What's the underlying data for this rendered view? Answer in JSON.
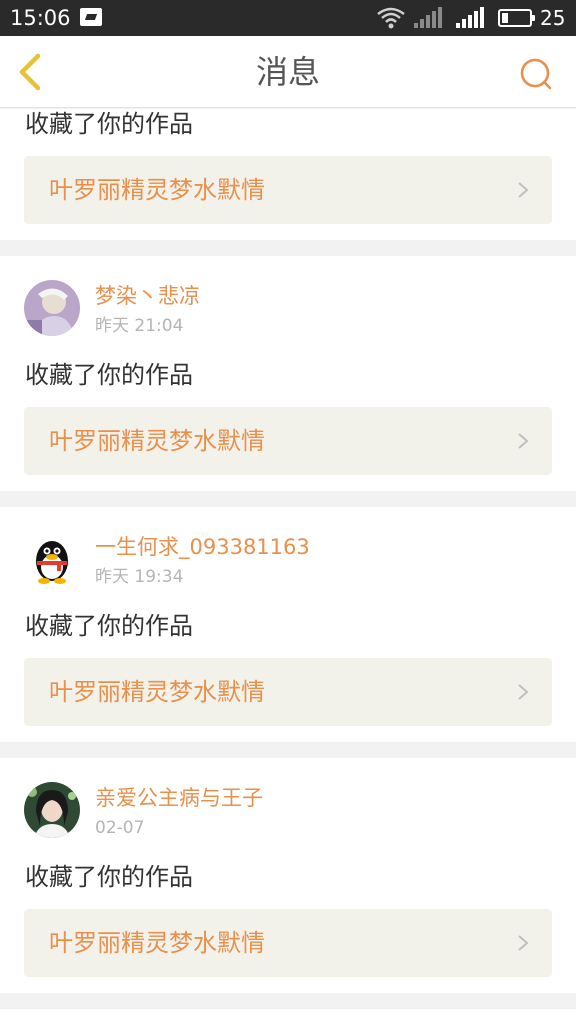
{
  "status_bar": {
    "time": "15:06",
    "battery_level": "25",
    "icons": [
      "image-notification-icon",
      "wifi-icon",
      "signal-empty-icon",
      "signal-icon",
      "battery-icon"
    ]
  },
  "header": {
    "title": "消息",
    "back_icon": "chevron-left-icon",
    "search_icon": "search-icon"
  },
  "colors": {
    "accent": "#e8904c",
    "back_chevron": "#e5c23a",
    "link_bg": "#f3f2ea",
    "muted": "#b5b5b5"
  },
  "messages": [
    {
      "action": "收藏了你的作品",
      "work_title": "叶罗丽精灵梦水默情"
    },
    {
      "user": "梦染丶悲凉",
      "time": "昨天 21:04",
      "action": "收藏了你的作品",
      "work_title": "叶罗丽精灵梦水默情"
    },
    {
      "user": "一生何求_093381163",
      "time": "昨天 19:34",
      "action": "收藏了你的作品",
      "work_title": "叶罗丽精灵梦水默情"
    },
    {
      "user": "亲爱公主病与王子",
      "time": "02-07",
      "action": "收藏了你的作品",
      "work_title": "叶罗丽精灵梦水默情"
    }
  ]
}
